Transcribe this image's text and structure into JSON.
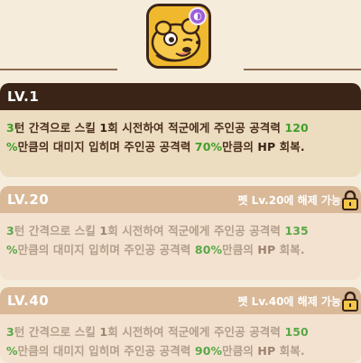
{
  "pet": {
    "badge_icon": "purple-element-badge-icon",
    "portrait_icon": "yellow-ferret-pet-portrait"
  },
  "levels": [
    {
      "level": "LV.1",
      "locked": false,
      "desc": {
        "p1": "3",
        "p2": "턴 간격으로 스킬 ",
        "p3": "1",
        "p4": "회 시전하여 적군에게 주인공 공격력 ",
        "p5": "120",
        "p6": "%",
        "p7": "만큼의 대미지 입히며 주인공 공격력 ",
        "p8": "70%",
        "p9": "만큼의 ",
        "p10": "HP",
        "p11": " 회복."
      }
    },
    {
      "level": "LV.20",
      "locked": true,
      "unlock": "펫 Lv.20에 해제 가능",
      "desc": {
        "p1": "3",
        "p2": "턴 간격으로 스킬 ",
        "p3": "1",
        "p4": "회 시전하여 적군에게 주인공 공격력 ",
        "p5": "135",
        "p6": "%",
        "p7": "만큼의 대미지 입히며 주인공 공격력 ",
        "p8": "80%",
        "p9": "만큼의 ",
        "p10": "HP",
        "p11": " 회복."
      }
    },
    {
      "level": "LV.40",
      "locked": true,
      "unlock": "펫 Lv.40에 해제 가능",
      "desc": {
        "p1": "3",
        "p2": "턴 간격으로 스킬 ",
        "p3": "1",
        "p4": "회 시전하여 적군에게 주인공 공격력 ",
        "p5": "150",
        "p6": "%",
        "p7": "만큼의 대미지 입히며 주인공 공격력 ",
        "p8": "90%",
        "p9": "만큼의 ",
        "p10": "HP",
        "p11": " 회복."
      }
    }
  ],
  "colors": {
    "background": "#f5ecdb",
    "active_header": "#3a2418",
    "locked_header": "#d9b998",
    "highlight_green": "#3fa02a",
    "highlight_orange": "#c88a15",
    "badge_purple": "#9b5fd9"
  }
}
